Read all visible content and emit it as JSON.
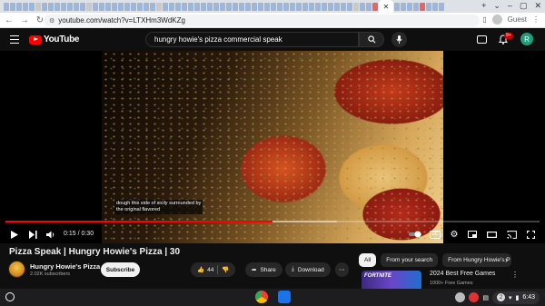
{
  "browser": {
    "url": "youtube.com/watch?v=LTXHm3WdKZg",
    "profile_label": "Guest"
  },
  "yt_header": {
    "logo_text": "YouTube",
    "search_query": "hungry howie's pizza commercial speak",
    "notification_count": "9+",
    "user_initial": "R"
  },
  "player": {
    "caption_lines": [
      "dough this side of sicily surrounded by",
      "the original flavored"
    ],
    "time_display": "0:15 / 0:30",
    "progress_fraction": 0.5,
    "buffer_fraction": 0.62,
    "cc_label": "CC"
  },
  "video_info": {
    "title": "Pizza Speak | Hungry Howie's Pizza | 30",
    "channel_name": "Hungry Howie's Pizza",
    "subscribers": "2.02K subscribers",
    "subscribe_label": "Subscribe",
    "like_count": "44",
    "share_label": "Share",
    "download_label": "Download"
  },
  "sidebar": {
    "chips": [
      "All",
      "From your search",
      "From Hungry Howie's P"
    ],
    "recommendation": {
      "thumb_text": "FORTNITE",
      "title": "2024 Best Free Games",
      "subtitle": "1000+ Free Games"
    }
  },
  "shelf": {
    "notification_count": "2",
    "clock": "6:43"
  },
  "colors": {
    "yt_red": "#ff0000",
    "bg": "#0f0f0f",
    "avatar": "#1f9e7a"
  }
}
